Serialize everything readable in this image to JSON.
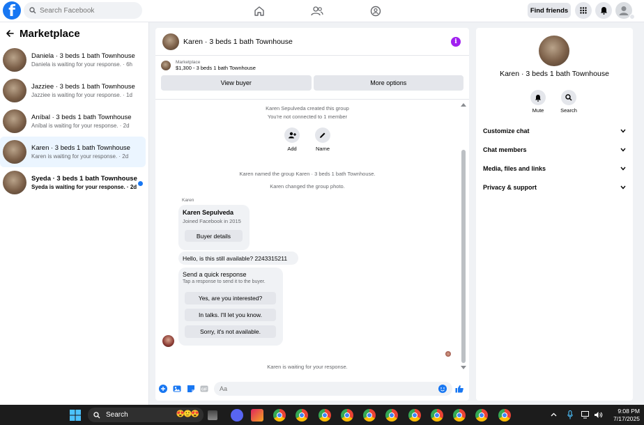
{
  "topbar": {
    "search_placeholder": "Search Facebook",
    "find_friends": "Find friends"
  },
  "sidebar": {
    "title": "Marketplace",
    "conversations": [
      {
        "title": "Daniela · 3 beds 1 bath Townhouse",
        "status": "Daniela is waiting for your response. · 6h"
      },
      {
        "title": "Jazziee · 3 beds 1 bath Townhouse",
        "status": "Jazziee is waiting for your response. · 1d"
      },
      {
        "title": "Aníbal · 3 beds 1 bath Townhouse",
        "status": "Aníbal is waiting for your response. · 2d"
      },
      {
        "title": "Karen · 3 beds 1 bath Townhouse",
        "status": "Karen is waiting for your response. · 2d"
      },
      {
        "title": "Syeda · 3 beds 1 bath Townhouse",
        "status": "Syeda is waiting for your response. · 2d"
      }
    ]
  },
  "chat": {
    "title": "Karen · 3 beds 1 bath Townhouse",
    "marketplace_label": "Marketplace",
    "listing": "$1,300 - 3 beds 1 bath Townhouse",
    "view_buyer": "View buyer",
    "more_options": "More options",
    "created_note": "Karen Sepulveda created this group",
    "connected_note": "You're not connected to 1 member",
    "add_label": "Add",
    "name_label": "Name",
    "named_note": "Karen named the group Karen · 3 beds 1 bath Townhouse.",
    "photo_note": "Karen changed the group photo.",
    "sender": "Karen",
    "card_name": "Karen Sepulveda",
    "card_joined": "Joined Facebook in 2015",
    "buyer_details": "Buyer details",
    "message": "Hello, is this still available? 2243315211",
    "quick_title": "Send a quick response",
    "quick_sub": "Tap a response to send it to the buyer.",
    "quick_1": "Yes, are you interested?",
    "quick_2": "In talks. I'll let you know.",
    "quick_3": "Sorry, it's not available.",
    "waiting_note": "Karen is waiting for your response.",
    "composer_placeholder": "Aa"
  },
  "details": {
    "title": "Karen · 3 beds 1 bath Townhouse",
    "mute": "Mute",
    "search": "Search",
    "sections": [
      "Customize chat",
      "Chat members",
      "Media, files and links",
      "Privacy & support"
    ]
  },
  "taskbar": {
    "search": "Search",
    "time": "9:08 PM",
    "date": "7/17/2025"
  },
  "colors": {
    "brand": "#1877f2",
    "info": "#a020f0"
  }
}
